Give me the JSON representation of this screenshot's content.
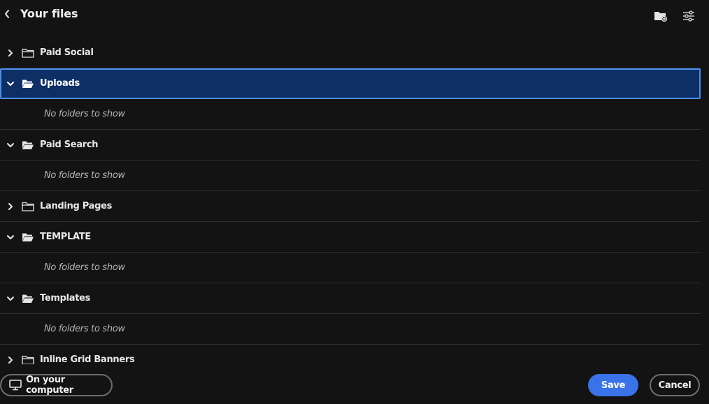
{
  "header": {
    "title": "Your files",
    "back_icon": "chevron-left-icon",
    "new_folder_icon": "new-folder-icon",
    "filter_icon": "sliders-icon"
  },
  "tree": {
    "empty_text": "No folders to show",
    "rows": [
      {
        "type": "folder",
        "label": "Paid Social",
        "expanded": false,
        "selected": false
      },
      {
        "type": "folder",
        "label": "Uploads",
        "expanded": true,
        "selected": true
      },
      {
        "type": "empty",
        "label": "No folders to show"
      },
      {
        "type": "folder",
        "label": "Paid Search",
        "expanded": true,
        "selected": false
      },
      {
        "type": "empty",
        "label": "No folders to show"
      },
      {
        "type": "folder",
        "label": "Landing Pages",
        "expanded": false,
        "selected": false
      },
      {
        "type": "folder",
        "label": "TEMPLATE",
        "expanded": true,
        "selected": false
      },
      {
        "type": "empty",
        "label": "No folders to show"
      },
      {
        "type": "folder",
        "label": "Templates",
        "expanded": true,
        "selected": false
      },
      {
        "type": "empty",
        "label": "No folders to show"
      },
      {
        "type": "folder",
        "label": "Inline Grid Banners",
        "expanded": false,
        "selected": false
      }
    ]
  },
  "footer": {
    "computer_label": "On your computer",
    "computer_icon": "monitor-icon",
    "save_label": "Save",
    "cancel_label": "Cancel"
  },
  "colors": {
    "background": "#131313",
    "selected_bg": "#0d2f66",
    "selected_border": "#4d8ef0",
    "accent": "#3a73e8"
  }
}
